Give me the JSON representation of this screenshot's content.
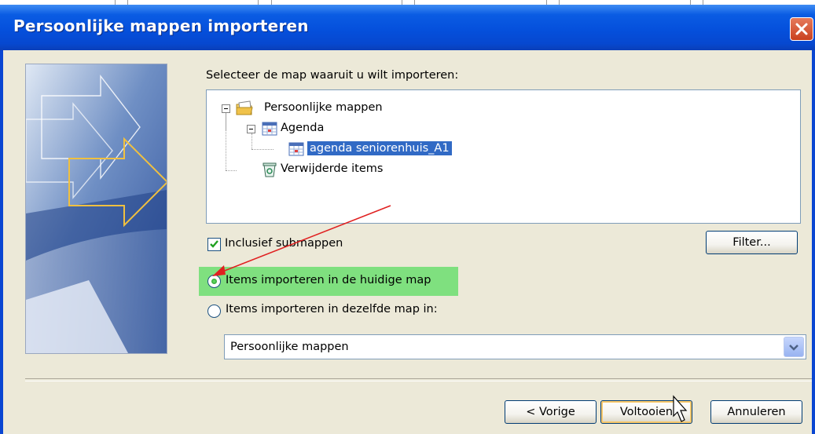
{
  "window": {
    "title": "Persoonlijke mappen importeren"
  },
  "prompt_label": "Selecteer de map waaruit u wilt importeren:",
  "tree": {
    "root": "Persoonlijke mappen",
    "agenda": "Agenda",
    "selected_item": "agenda seniorenhuis_A1",
    "deleted": "Verwijderde items"
  },
  "include_subfolders": {
    "label": "Inclusief submappen",
    "checked": true
  },
  "filter_button": "Filter...",
  "options": {
    "current_folder": "Items importeren in de huidige map",
    "same_folder": "Items importeren in dezelfde map in:",
    "selected": "current_folder"
  },
  "target_folder": {
    "value": "Persoonlijke mappen"
  },
  "buttons": {
    "back": "< Vorige",
    "finish": "Voltooien",
    "cancel": "Annuleren"
  },
  "colors": {
    "highlight": "#7fe07f",
    "arrow": "#e02020",
    "selection": "#316ac5"
  }
}
